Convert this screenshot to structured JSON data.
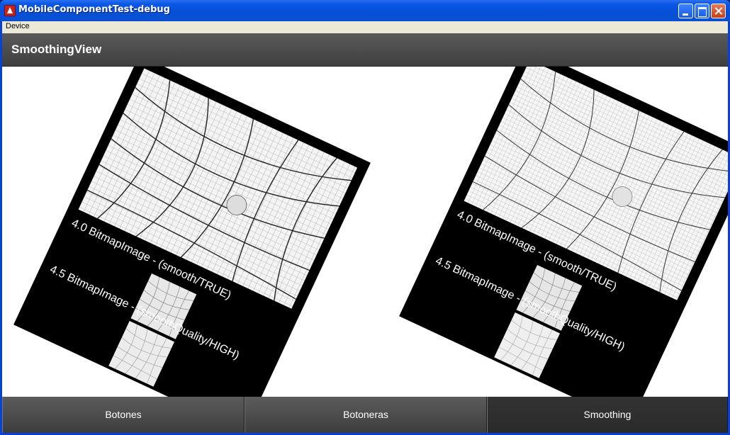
{
  "window": {
    "title": "MobileComponentTest-debug"
  },
  "menubar": {
    "items": [
      "Device"
    ]
  },
  "actionbar": {
    "title": "SmoothingView"
  },
  "cards": [
    {
      "label_1": "4.0 BitmapImage - (smooth/TRUE)",
      "label_2": "4.5 BitmapImage - (smoothQuality/HIGH)"
    },
    {
      "label_1": "4.0 BitmapImage - (smooth/TRUE)",
      "label_2": "4.5 BitmapImage - (smoothQuality/HIGH)"
    }
  ],
  "tabs": [
    {
      "label": "Botones",
      "selected": false
    },
    {
      "label": "Botoneras",
      "selected": false
    },
    {
      "label": "Smoothing",
      "selected": true
    }
  ],
  "colors": {
    "title_bar": "#0a57e6",
    "action_bar": "#4a4a4a",
    "tab_bar": "#3d3d3d",
    "selected_tab": "#2f2f2f"
  }
}
